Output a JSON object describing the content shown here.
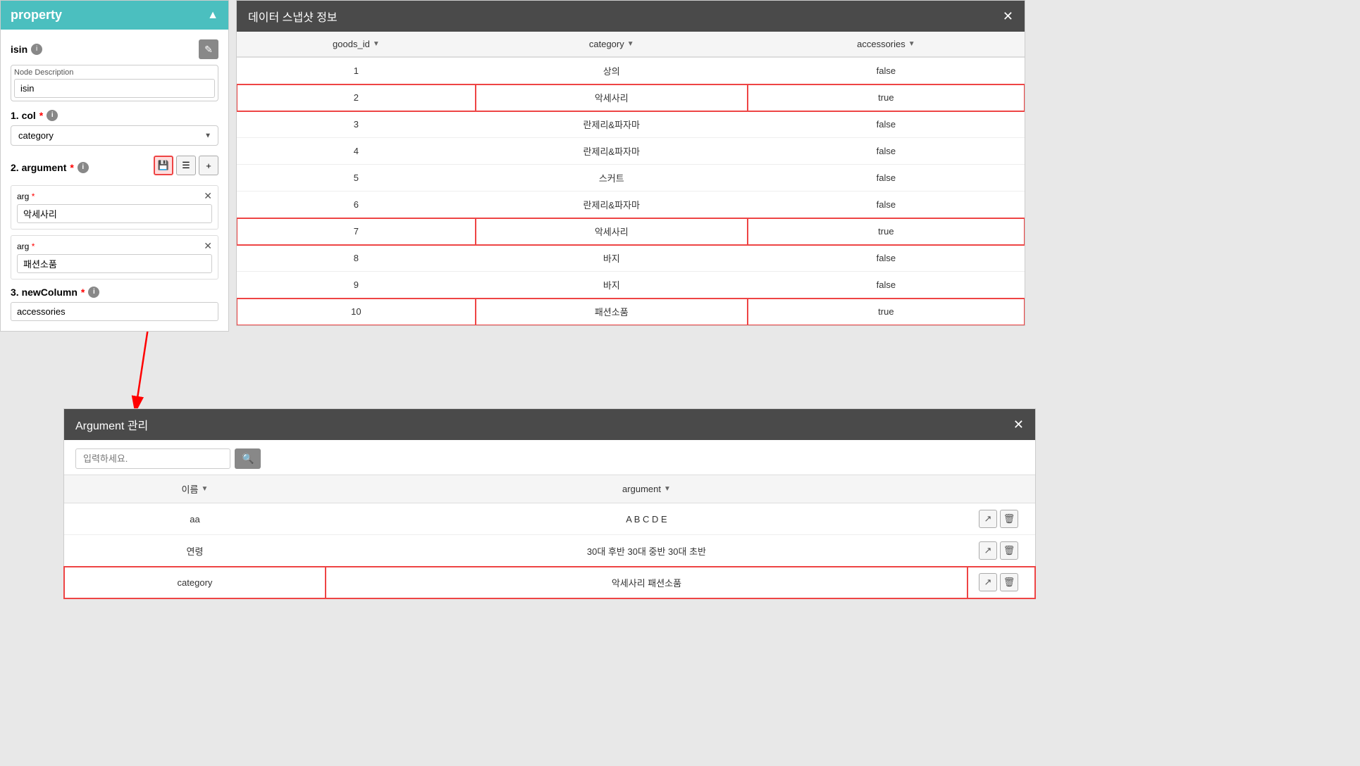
{
  "leftPanel": {
    "title": "property",
    "closeIcon": "^",
    "isinLabel": "isin",
    "editIconLabel": "✎",
    "nodeDesc": {
      "label": "Node Description",
      "value": "isin"
    },
    "col": {
      "sectionLabel": "1. col",
      "required": "*",
      "selectedValue": "category"
    },
    "argument": {
      "sectionLabel": "2. argument",
      "required": "*",
      "args": [
        {
          "label": "arg",
          "required": "*",
          "value": "악세사리"
        },
        {
          "label": "arg",
          "required": "*",
          "value": "패션소품"
        }
      ]
    },
    "newColumn": {
      "sectionLabel": "3. newColumn",
      "required": "*",
      "value": "accessories"
    }
  },
  "snapshotModal": {
    "title": "데이터 스냅샷 정보",
    "columns": [
      "goods_id",
      "category",
      "accessories"
    ],
    "rows": [
      {
        "goods_id": "1",
        "category": "상의",
        "accessories": "false",
        "highlighted": false
      },
      {
        "goods_id": "2",
        "category": "악세사리",
        "accessories": "true",
        "highlighted": true
      },
      {
        "goods_id": "3",
        "category": "란제리&파자마",
        "accessories": "false",
        "highlighted": false
      },
      {
        "goods_id": "4",
        "category": "란제리&파자마",
        "accessories": "false",
        "highlighted": false
      },
      {
        "goods_id": "5",
        "category": "스커트",
        "accessories": "false",
        "highlighted": false
      },
      {
        "goods_id": "6",
        "category": "란제리&파자마",
        "accessories": "false",
        "highlighted": false
      },
      {
        "goods_id": "7",
        "category": "악세사리",
        "accessories": "true",
        "highlighted": true
      },
      {
        "goods_id": "8",
        "category": "바지",
        "accessories": "false",
        "highlighted": false
      },
      {
        "goods_id": "9",
        "category": "바지",
        "accessories": "false",
        "highlighted": false
      },
      {
        "goods_id": "10",
        "category": "패션소품",
        "accessories": "true",
        "highlighted": true
      }
    ]
  },
  "argModal": {
    "title": "Argument 관리",
    "searchPlaceholder": "입력하세요.",
    "searchIcon": "🔍",
    "columns": [
      "이름",
      "argument"
    ],
    "rows": [
      {
        "name": "aa",
        "argument": "A B C D E",
        "highlighted": false
      },
      {
        "name": "연령",
        "argument": "30대 후반 30대 중반 30대 초반",
        "highlighted": false
      },
      {
        "name": "category",
        "argument": "악세사리 패션소품",
        "highlighted": true
      }
    ]
  },
  "icons": {
    "chevronUp": "▲",
    "chevronDown": "▼",
    "close": "✕",
    "save": "💾",
    "list": "☰",
    "add": "+",
    "search": "🔍",
    "arrowRight": "→",
    "trash": "🗑",
    "import": "↗"
  }
}
